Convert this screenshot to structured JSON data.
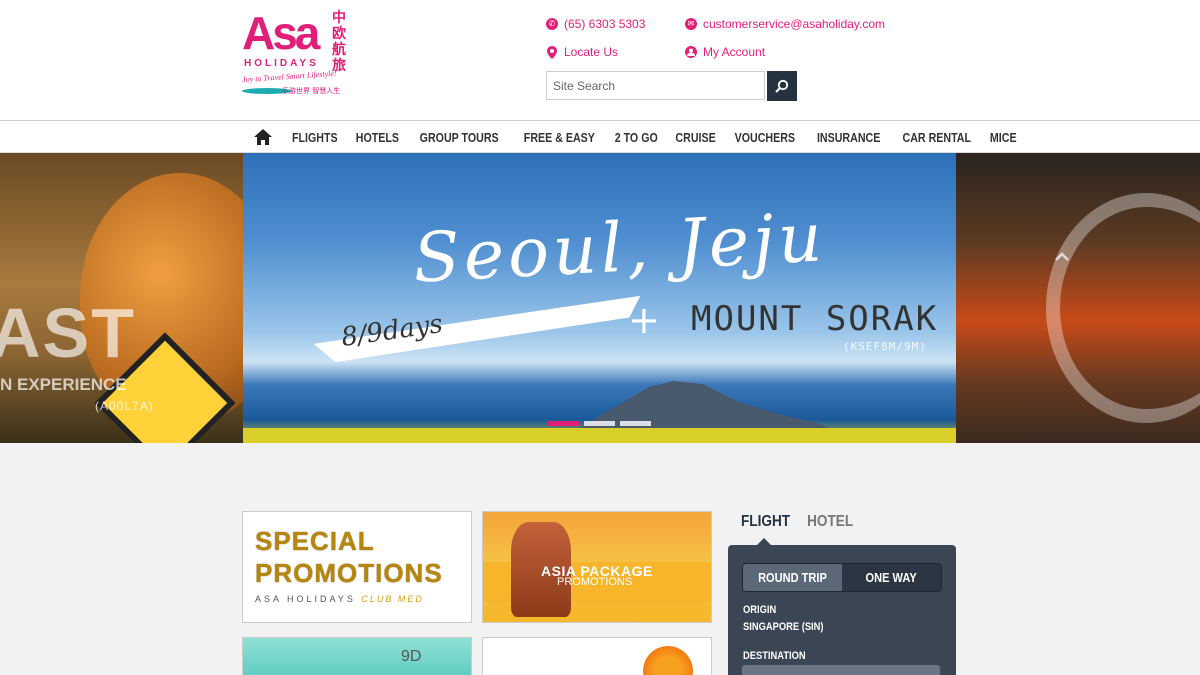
{
  "header": {
    "logo": {
      "asa": "Asa",
      "chinese": "中欧航旅",
      "holidays": "HOLIDAYS",
      "slogan": "Joy to Travel Smart Lifestyle!",
      "slogan_cn": "乐游世界 智慧人生"
    },
    "phone": "(65) 6303 5303",
    "email": "customerservice@asaholiday.com",
    "locate": "Locate Us",
    "account": "My Account",
    "search": {
      "placeholder": "Site Search"
    }
  },
  "nav": {
    "items": [
      "FLIGHTS",
      "HOTELS",
      "GROUP TOURS",
      "FREE & EASY",
      "2 TO GO",
      "CRUISE",
      "VOUCHERS",
      "INSURANCE",
      "CAR RENTAL",
      "MICE"
    ]
  },
  "hero": {
    "left": {
      "big": "AST",
      "sub": "N EXPERIENCE",
      "code": "(A00L7A)"
    },
    "main": {
      "title": "Seoul, Jeju",
      "days": "8/9days",
      "plus": "+",
      "mount": "MOUNT SORAK",
      "code": "(KSEF8M/9M)"
    },
    "slides": 3,
    "active_slide": 0
  },
  "cards": {
    "special": {
      "line1": "SPECIAL",
      "line2": "PROMOTIONS",
      "sub": "ASA HOLIDAYS",
      "club": "CLUB MED"
    },
    "asia": {
      "line1": "ASIA PACKAGE",
      "line2": "PROMOTIONS"
    },
    "teal": {
      "text": "9D"
    }
  },
  "widget": {
    "tabs": {
      "flight": "FLIGHT",
      "hotel": "HOTEL"
    },
    "round_trip": "ROUND TRIP",
    "one_way": "ONE WAY",
    "origin_label": "ORIGIN",
    "origin_value": "SINGAPORE (SIN)",
    "destination_label": "DESTINATION"
  },
  "colors": {
    "brand_pink": "#e21f78",
    "brand_teal": "#1eaab1",
    "dark_navy": "#253240"
  }
}
